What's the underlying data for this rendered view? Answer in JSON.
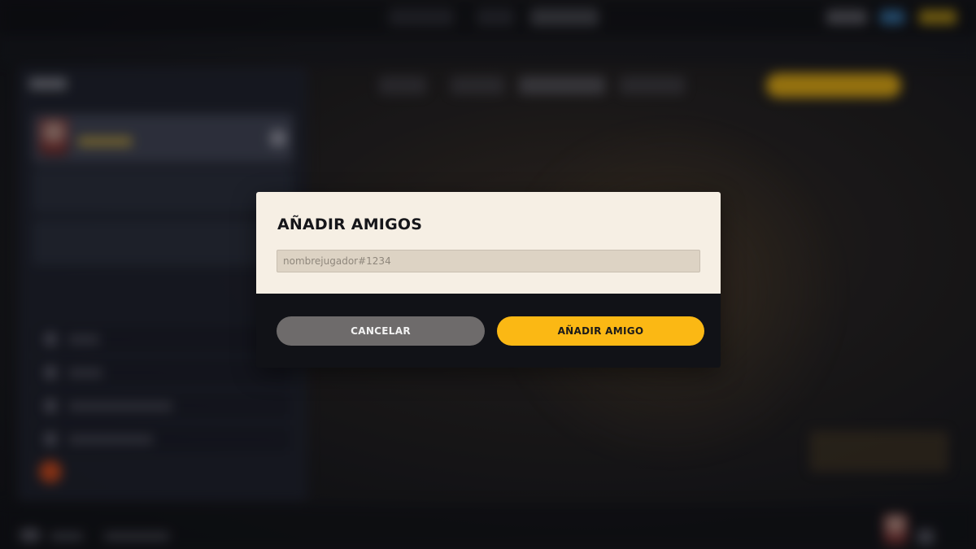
{
  "dialog": {
    "title": "AÑADIR AMIGOS",
    "input": {
      "value": "",
      "placeholder": "nombrejugador#1234"
    },
    "cancel_label": "CANCELAR",
    "confirm_label": "AÑADIR AMIGO"
  },
  "colors": {
    "accent": "#fbb814",
    "dialog_background": "#f6efe4",
    "button_secondary": "#6e6b6b",
    "footer_background": "#111217"
  }
}
